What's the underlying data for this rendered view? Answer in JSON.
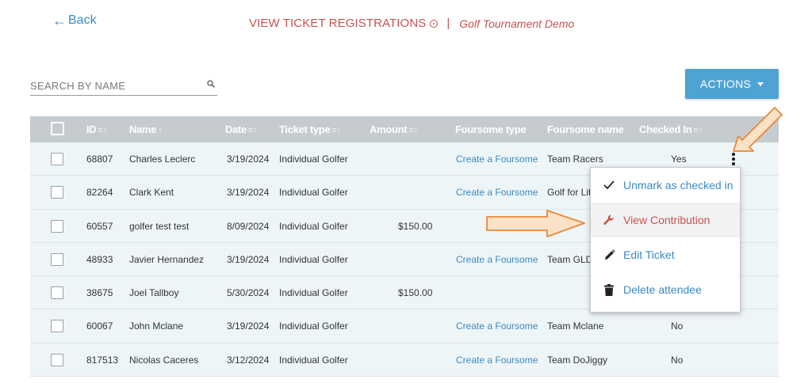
{
  "back": {
    "label": "Back"
  },
  "header": {
    "title": "VIEW TICKET REGISTRATIONS",
    "separator": "|",
    "event": "Golf Tournament Demo"
  },
  "search": {
    "placeholder": "SEARCH BY NAME"
  },
  "actions": {
    "label": "ACTIONS"
  },
  "table": {
    "columns": [
      "ID",
      "Name",
      "Date",
      "Ticket type",
      "Amount",
      "Foursome type",
      "Foursome name",
      "Checked In"
    ],
    "rows": [
      {
        "id": "68807",
        "name": "Charles Leclerc",
        "date": "3/19/2024",
        "ticket_type": "Individual Golfer",
        "amount": "",
        "foursome_type": "Create a Foursome",
        "foursome_name": "Team Racers",
        "checked_in": "Yes"
      },
      {
        "id": "82264",
        "name": "Clark Kent",
        "date": "3/19/2024",
        "ticket_type": "Individual Golfer",
        "amount": "",
        "foursome_type": "Create a Foursome",
        "foursome_name": "Golf for Lit",
        "checked_in": ""
      },
      {
        "id": "60557",
        "name": "golfer test test",
        "date": "8/09/2024",
        "ticket_type": "Individual Golfer",
        "amount": "$150.00",
        "foursome_type": "",
        "foursome_name": "",
        "checked_in": ""
      },
      {
        "id": "48933",
        "name": "Javier Hernandez",
        "date": "3/19/2024",
        "ticket_type": "Individual Golfer",
        "amount": "",
        "foursome_type": "Create a Foursome",
        "foursome_name": "Team GLD",
        "checked_in": ""
      },
      {
        "id": "38675",
        "name": "Joel Tallboy",
        "date": "5/30/2024",
        "ticket_type": "Individual Golfer",
        "amount": "$150.00",
        "foursome_type": "",
        "foursome_name": "",
        "checked_in": ""
      },
      {
        "id": "60067",
        "name": "John Mclane",
        "date": "3/19/2024",
        "ticket_type": "Individual Golfer",
        "amount": "",
        "foursome_type": "Create a Foursome",
        "foursome_name": "Team Mclane",
        "checked_in": "No"
      },
      {
        "id": "817513",
        "name": "Nicolas Caceres",
        "date": "3/12/2024",
        "ticket_type": "Individual Golfer",
        "amount": "",
        "foursome_type": "Create a Foursome",
        "foursome_name": "Team DoJiggy",
        "checked_in": "No"
      }
    ]
  },
  "menu": {
    "items": [
      {
        "label": "Unmark as checked in",
        "icon": "checkmark-icon"
      },
      {
        "label": "View Contribution",
        "icon": "wrench-icon"
      },
      {
        "label": "Edit Ticket",
        "icon": "pencil-icon"
      },
      {
        "label": "Delete attendee",
        "icon": "trash-icon"
      }
    ]
  },
  "colors": {
    "accent": "#4fa3d4",
    "link": "#3b8ac4",
    "title": "#c9514e",
    "header_bg": "#c5cbcf",
    "row_bg": "#eef5f7",
    "annotation": "#e8883a"
  }
}
